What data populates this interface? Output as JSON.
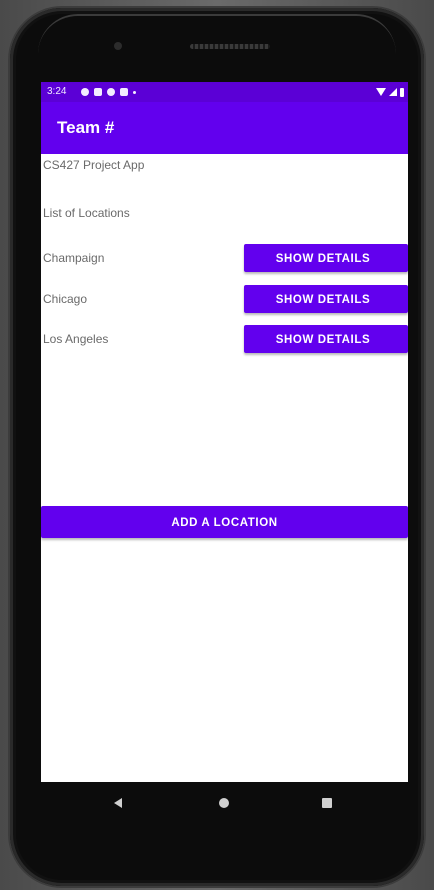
{
  "status_bar": {
    "time": "3:24"
  },
  "app_bar": {
    "title": "Team #"
  },
  "main": {
    "app_heading": "CS427 Project App",
    "list_heading": "List of Locations",
    "locations": [
      {
        "name": "Champaign",
        "button_label": "SHOW DETAILS"
      },
      {
        "name": "Chicago",
        "button_label": "SHOW DETAILS"
      },
      {
        "name": "Los Angeles",
        "button_label": "SHOW DETAILS"
      }
    ],
    "add_button_label": "ADD A LOCATION"
  },
  "colors": {
    "primary": "#6200ee",
    "primary_dark": "#5b00d6",
    "text": "#6a6a6a"
  },
  "nav_bar": {
    "icons": [
      "back-icon",
      "home-icon",
      "recents-icon"
    ]
  }
}
